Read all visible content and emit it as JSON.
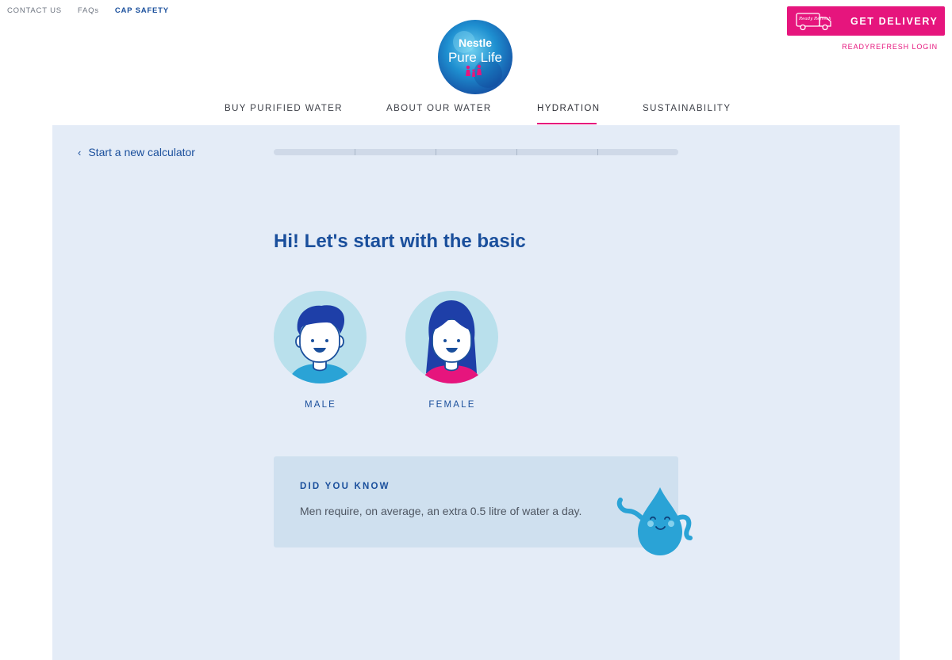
{
  "utility_nav": [
    "CONTACT US",
    "FAQs",
    "CAP SAFETY"
  ],
  "delivery": {
    "truck_text": "Ready Refresh",
    "button_label": "GET DELIVERY",
    "login_label": "READYREFRESH LOGIN"
  },
  "logo": {
    "line1": "Nestle",
    "line2": "Pure Life"
  },
  "main_nav": [
    "BUY PURIFIED WATER",
    "ABOUT OUR WATER",
    "HYDRATION",
    "SUSTAINABILITY"
  ],
  "active_nav": "HYDRATION",
  "calculator": {
    "back_label": "Start a new calculator",
    "progress": {
      "steps": 5,
      "completed": 0
    },
    "heading": "Hi! Let's start with the basic",
    "options": [
      {
        "label": "MALE"
      },
      {
        "label": "FEMALE"
      }
    ]
  },
  "tip": {
    "title": "DID YOU KNOW",
    "text": "Men require, on average, an extra 0.5 litre of water a day."
  },
  "colors": {
    "brand_pink": "#e6157d",
    "brand_blue": "#1a4f9c",
    "panel_bg": "#e4ecf7",
    "tip_bg": "#cfe0ef",
    "avatar_bg": "#b9e0ec",
    "drop": "#2aa3d6"
  },
  "icons": {
    "back": "chevron-left-icon",
    "truck": "delivery-truck-icon",
    "mascot": "water-drop-mascot"
  }
}
